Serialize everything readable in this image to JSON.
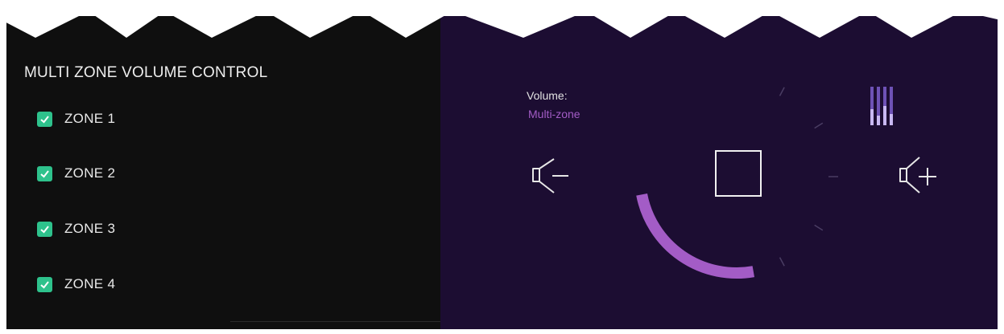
{
  "panel": {
    "title": "MULTI ZONE VOLUME CONTROL"
  },
  "zones": [
    {
      "label": "ZONE 1",
      "checked": true
    },
    {
      "label": "ZONE 2",
      "checked": true
    },
    {
      "label": "ZONE 3",
      "checked": true
    },
    {
      "label": "ZONE 4",
      "checked": true
    }
  ],
  "volume": {
    "title": "Volume:",
    "mode": "Multi-zone",
    "level": 0.4,
    "icons": {
      "decrease": "speaker-minus-icon",
      "increase": "speaker-plus-icon",
      "stop": "stop-square-icon",
      "equalizer": "equalizer-bars-icon"
    }
  },
  "colors": {
    "left_background": "#0f0f0f",
    "right_background": "#1c0d32",
    "check_accent": "#2ec28c",
    "volume_arc": "#a35cc6",
    "mode_text": "#a35cc6"
  }
}
